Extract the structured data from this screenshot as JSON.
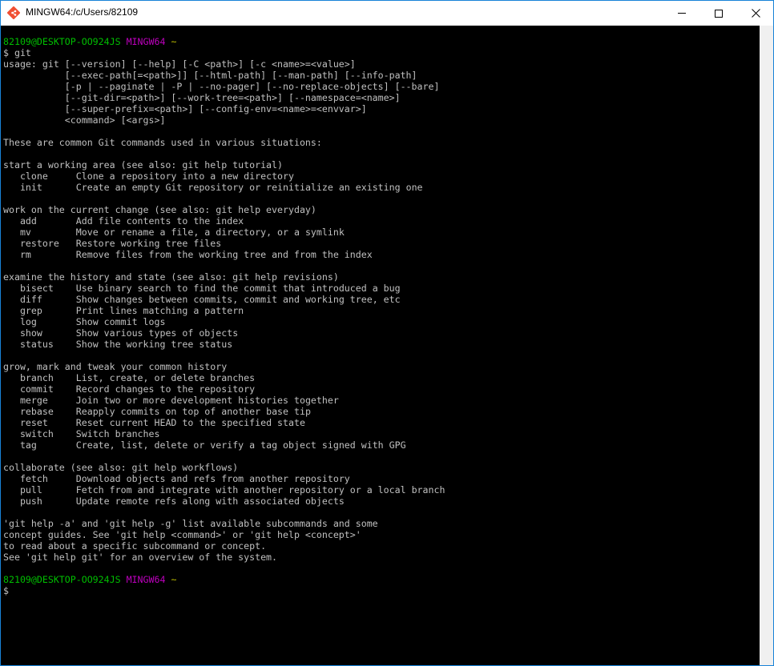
{
  "window": {
    "title": "MINGW64:/c/Users/82109",
    "accent": "#1883d7"
  },
  "icons": {
    "app": "git-bash-icon",
    "minimize": "minimize-icon",
    "maximize": "maximize-icon",
    "close": "close-icon"
  },
  "colors": {
    "prompt_user": "#00bf00",
    "prompt_system": "#bf00bf",
    "prompt_path": "#bfbf00",
    "text": "#c0c0c0",
    "background": "#000000"
  },
  "prompt1": {
    "user_host": "82109@DESKTOP-OO924JS",
    "system": "MINGW64",
    "path": "~"
  },
  "command": "$ git",
  "usage": [
    "usage: git [--version] [--help] [-C <path>] [-c <name>=<value>]",
    "           [--exec-path[=<path>]] [--html-path] [--man-path] [--info-path]",
    "           [-p | --paginate | -P | --no-pager] [--no-replace-objects] [--bare]",
    "           [--git-dir=<path>] [--work-tree=<path>] [--namespace=<name>]",
    "           [--super-prefix=<path>] [--config-env=<name>=<envvar>]",
    "           <command> [<args>]"
  ],
  "intro": "These are common Git commands used in various situations:",
  "sections": [
    {
      "heading": "start a working area (see also: git help tutorial)",
      "commands": [
        {
          "name": "clone",
          "desc": "Clone a repository into a new directory"
        },
        {
          "name": "init",
          "desc": "Create an empty Git repository or reinitialize an existing one"
        }
      ]
    },
    {
      "heading": "work on the current change (see also: git help everyday)",
      "commands": [
        {
          "name": "add",
          "desc": "Add file contents to the index"
        },
        {
          "name": "mv",
          "desc": "Move or rename a file, a directory, or a symlink"
        },
        {
          "name": "restore",
          "desc": "Restore working tree files"
        },
        {
          "name": "rm",
          "desc": "Remove files from the working tree and from the index"
        }
      ]
    },
    {
      "heading": "examine the history and state (see also: git help revisions)",
      "commands": [
        {
          "name": "bisect",
          "desc": "Use binary search to find the commit that introduced a bug"
        },
        {
          "name": "diff",
          "desc": "Show changes between commits, commit and working tree, etc"
        },
        {
          "name": "grep",
          "desc": "Print lines matching a pattern"
        },
        {
          "name": "log",
          "desc": "Show commit logs"
        },
        {
          "name": "show",
          "desc": "Show various types of objects"
        },
        {
          "name": "status",
          "desc": "Show the working tree status"
        }
      ]
    },
    {
      "heading": "grow, mark and tweak your common history",
      "commands": [
        {
          "name": "branch",
          "desc": "List, create, or delete branches"
        },
        {
          "name": "commit",
          "desc": "Record changes to the repository"
        },
        {
          "name": "merge",
          "desc": "Join two or more development histories together"
        },
        {
          "name": "rebase",
          "desc": "Reapply commits on top of another base tip"
        },
        {
          "name": "reset",
          "desc": "Reset current HEAD to the specified state"
        },
        {
          "name": "switch",
          "desc": "Switch branches"
        },
        {
          "name": "tag",
          "desc": "Create, list, delete or verify a tag object signed with GPG"
        }
      ]
    },
    {
      "heading": "collaborate (see also: git help workflows)",
      "commands": [
        {
          "name": "fetch",
          "desc": "Download objects and refs from another repository"
        },
        {
          "name": "pull",
          "desc": "Fetch from and integrate with another repository or a local branch"
        },
        {
          "name": "push",
          "desc": "Update remote refs along with associated objects"
        }
      ]
    }
  ],
  "footer": [
    "'git help -a' and 'git help -g' list available subcommands and some",
    "concept guides. See 'git help <command>' or 'git help <concept>'",
    "to read about a specific subcommand or concept.",
    "See 'git help git' for an overview of the system."
  ],
  "prompt2": {
    "user_host": "82109@DESKTOP-OO924JS",
    "system": "MINGW64",
    "path": "~"
  },
  "cursor_prompt": "$"
}
